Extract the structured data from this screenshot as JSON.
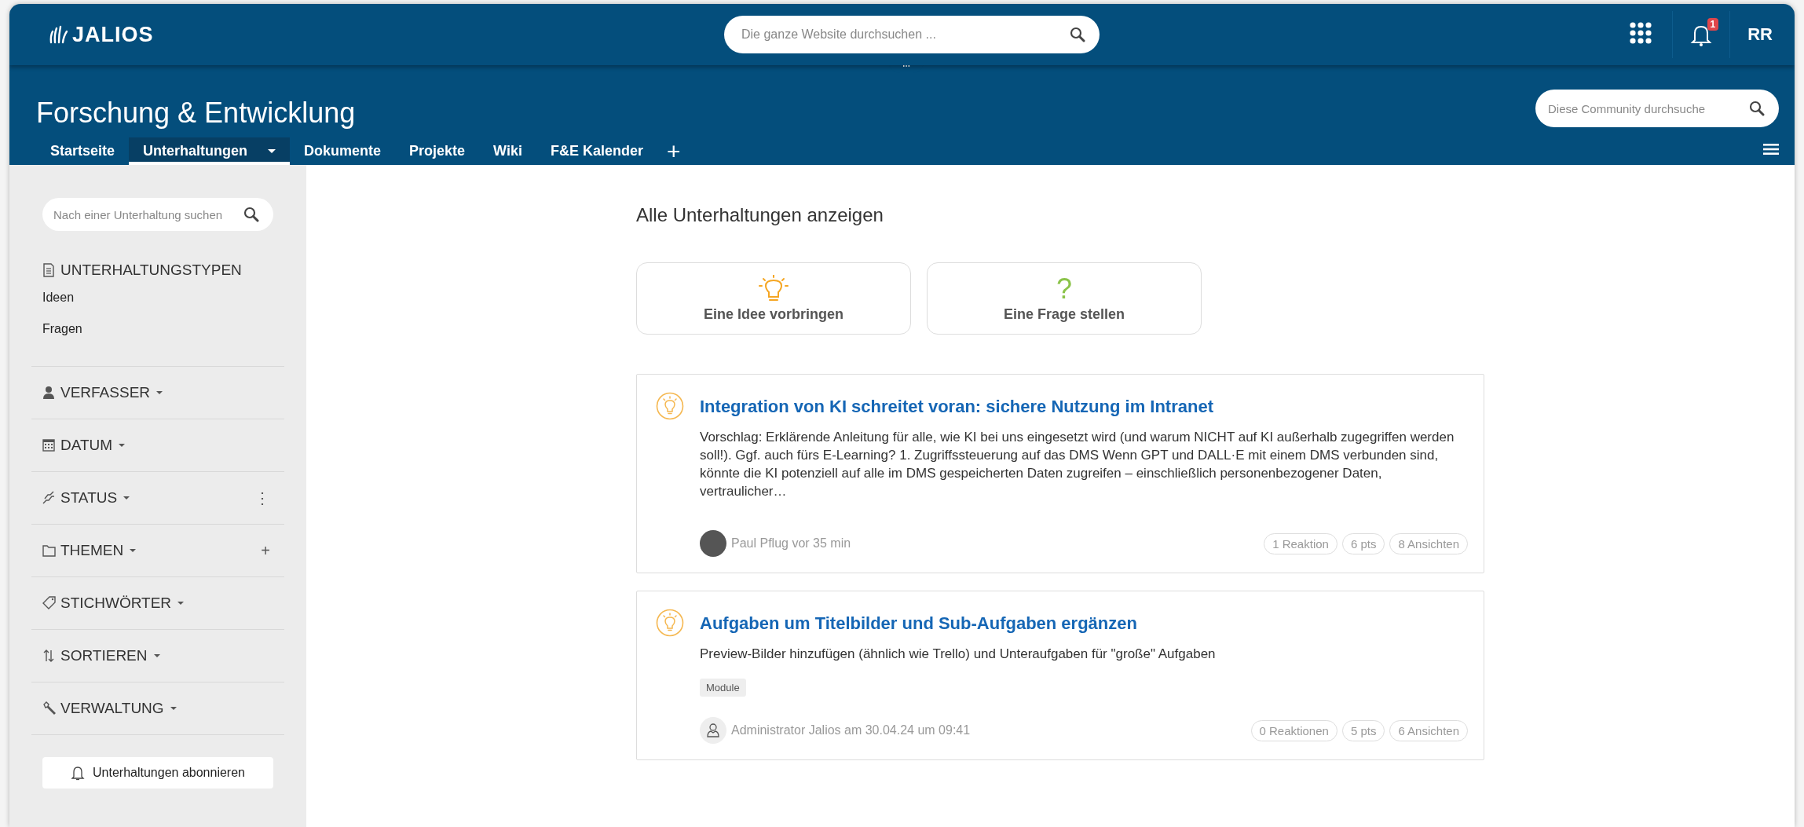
{
  "topbar": {
    "logo": "JALIOS",
    "search_placeholder": "Die ganze Website durchsuchen ...",
    "notification_count": "1",
    "user_initials": "RR"
  },
  "community": {
    "title": "Forschung & Entwicklung",
    "search_placeholder": "Diese Community durchsuche"
  },
  "tabs": [
    {
      "label": "Startseite",
      "selected": false,
      "dropdown": false
    },
    {
      "label": "Unterhaltungen",
      "selected": true,
      "dropdown": true
    },
    {
      "label": "Dokumente",
      "selected": false,
      "dropdown": false
    },
    {
      "label": "Projekte",
      "selected": false,
      "dropdown": false
    },
    {
      "label": "Wiki",
      "selected": false,
      "dropdown": false
    },
    {
      "label": "F&E Kalender",
      "selected": false,
      "dropdown": false
    }
  ],
  "add_tab": "+",
  "sidebar": {
    "search_placeholder": "Nach einer Unterhaltung suchen",
    "sections": [
      {
        "kind": "types",
        "title": "UNTERHALTUNGSTYPEN",
        "dropdown": false,
        "items": [
          "Ideen",
          "Fragen"
        ]
      },
      {
        "kind": "author",
        "title": "VERFASSER",
        "dropdown": true
      },
      {
        "kind": "date",
        "title": "DATUM",
        "dropdown": true
      },
      {
        "kind": "status",
        "title": "STATUS",
        "dropdown": true,
        "action_symbol": "⋮"
      },
      {
        "kind": "topics",
        "title": "THEMEN",
        "dropdown": true,
        "action_symbol": "+"
      },
      {
        "kind": "tags",
        "title": "STICHWÖRTER",
        "dropdown": true
      },
      {
        "kind": "sort",
        "title": "SORTIEREN",
        "dropdown": true
      },
      {
        "kind": "admin",
        "title": "VERWALTUNG",
        "dropdown": true
      }
    ],
    "subscribe_button": "Unterhaltungen abonnieren"
  },
  "main": {
    "heading": "Alle Unterhaltungen anzeigen",
    "create_buttons": [
      {
        "kind": "idea",
        "label": "Eine Idee vorbringen"
      },
      {
        "kind": "question",
        "symbol": "?",
        "label": "Eine Frage stellen"
      }
    ],
    "posts": [
      {
        "title": "Integration von KI schreitet voran: sichere Nutzung im Intranet",
        "excerpt": "Vorschlag: Erklärende Anleitung für alle, wie KI bei uns eingesetzt wird (und warum NICHT auf KI außerhalb zugegriffen werden soll!). Ggf. auch fürs E-Learning? 1. Zugriffssteuerung auf das DMS Wenn GPT und DALL·E mit einem DMS verbunden sind, könnte die KI potenziell auf alle im DMS gespeicherten Daten zugreifen – einschließlich personenbezogener Daten, vertraulicher…",
        "avatar": {
          "kind": "photo"
        },
        "meta": "Paul Pflug vor 35 min",
        "stats": [
          "1 Reaktion",
          "6 pts",
          "8 Ansichten"
        ]
      },
      {
        "title": "Aufgaben um Titelbilder und Sub-Aufgaben ergänzen",
        "excerpt": "Preview-Bilder hinzufügen (ähnlich wie Trello) und Unteraufgaben für \"große\" Aufgaben",
        "tags": [
          "Module"
        ],
        "avatar": {
          "kind": "default"
        },
        "meta": "Administrator Jalios am 30.04.24 um 09:41",
        "stats": [
          "0 Reaktionen",
          "5 pts",
          "6 Ansichten"
        ]
      }
    ]
  }
}
